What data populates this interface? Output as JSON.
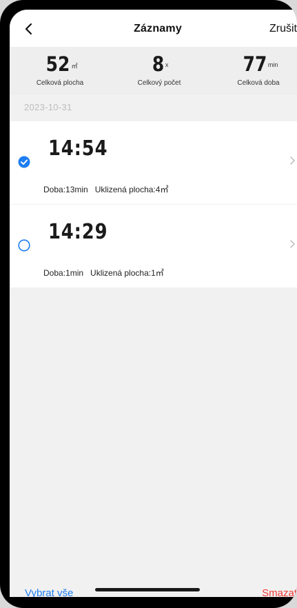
{
  "header": {
    "title": "Záznamy",
    "cancel_label": "Zrušit",
    "back_icon": "chevron-left-icon"
  },
  "stats": [
    {
      "value": "52",
      "unit": "㎡",
      "label": "Celková plocha"
    },
    {
      "value": "8",
      "unit": "x",
      "label": "Celkový počet"
    },
    {
      "value": "77",
      "unit": "min",
      "label": "Celková doba"
    }
  ],
  "date": "2023-10-31",
  "records": [
    {
      "time": "14:54",
      "duration": "Doba:13min",
      "area": "Uklizená plocha:4㎡",
      "selected": true
    },
    {
      "time": "14:29",
      "duration": "Doba:1min",
      "area": "Uklizená plocha:1㎡",
      "selected": false
    }
  ],
  "footer": {
    "select_all_label": "Vybrat vše",
    "delete_label": "Smazat"
  },
  "colors": {
    "accent": "#1d7df0",
    "danger": "#f23a33",
    "background": "#f1f1f1"
  }
}
